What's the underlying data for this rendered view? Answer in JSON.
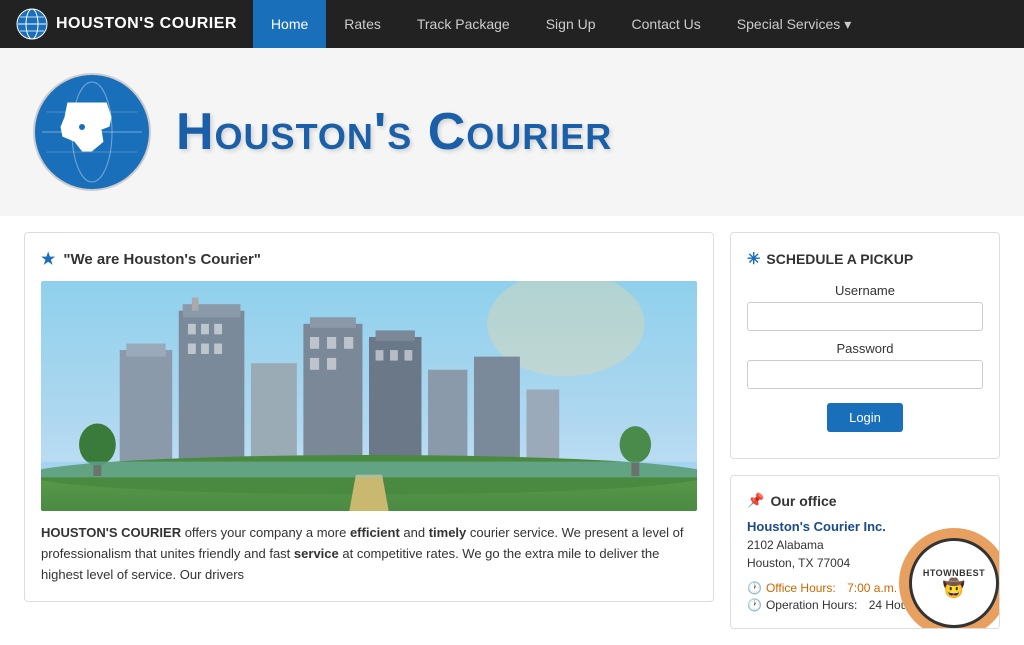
{
  "brand": {
    "name": "Houston's Courier",
    "icon_label": "globe-icon"
  },
  "nav": {
    "links": [
      {
        "label": "Home",
        "active": true,
        "id": "home"
      },
      {
        "label": "Rates",
        "active": false,
        "id": "rates"
      },
      {
        "label": "Track Package",
        "active": false,
        "id": "track"
      },
      {
        "label": "Sign Up",
        "active": false,
        "id": "signup"
      },
      {
        "label": "Contact Us",
        "active": false,
        "id": "contact"
      },
      {
        "label": "Special Services",
        "active": false,
        "id": "special",
        "dropdown": true
      }
    ]
  },
  "hero": {
    "title": "Houston's Courier"
  },
  "left": {
    "section_heading": "\"We are Houston's Courier\"",
    "body_text_1": " offers your company a more ",
    "body_text_2": " and ",
    "body_text_3": " courier service. We present a level of professionalism that unites friendly and fast ",
    "body_text_4": " at competitive rates. We go the extra mile to deliver the highest level of service. Our drivers",
    "strong_1": "HOUSTON'S COURIER",
    "strong_2": "efficient",
    "strong_3": "timely",
    "strong_4": "service"
  },
  "schedule": {
    "heading": "SCHEDULE A PICKUP",
    "username_label": "Username",
    "password_label": "Password",
    "login_label": "Login",
    "username_placeholder": "",
    "password_placeholder": ""
  },
  "office": {
    "heading": "Our office",
    "name": "Houston's Courier Inc.",
    "address_line1": "2102 Alabama",
    "address_line2": "Houston, TX 77004",
    "office_hours_label": "Office Hours:",
    "office_hours_value": "7:00 a.m. – 5:00 p.m.",
    "operation_hours_label": "Operation Hours:",
    "operation_hours_value": "24 Hours"
  },
  "badge": {
    "text": "HTOWNBEST",
    "icon": "🤠"
  }
}
